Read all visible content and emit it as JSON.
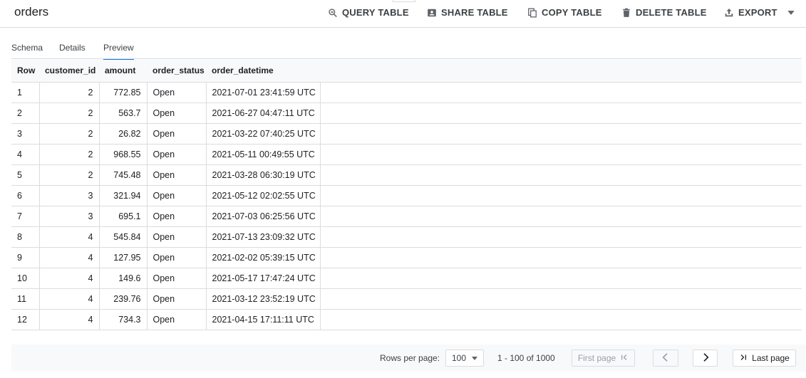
{
  "header": {
    "title": "orders",
    "actions": [
      {
        "label": "QUERY TABLE",
        "icon": "query-icon"
      },
      {
        "label": "SHARE TABLE",
        "icon": "share-icon"
      },
      {
        "label": "COPY TABLE",
        "icon": "copy-icon"
      },
      {
        "label": "DELETE TABLE",
        "icon": "trash-icon"
      },
      {
        "label": "EXPORT",
        "icon": "export-icon"
      }
    ]
  },
  "tabs": [
    {
      "label": "Schema",
      "active": false
    },
    {
      "label": "Details",
      "active": false
    },
    {
      "label": "Preview",
      "active": true
    }
  ],
  "table": {
    "columns": [
      "Row",
      "customer_id",
      "amount",
      "order_status",
      "order_datetime"
    ],
    "rows": [
      [
        "1",
        "2",
        "772.85",
        "Open",
        "2021-07-01 23:41:59 UTC"
      ],
      [
        "2",
        "2",
        "563.7",
        "Open",
        "2021-06-27 04:47:11 UTC"
      ],
      [
        "3",
        "2",
        "26.82",
        "Open",
        "2021-03-22 07:40:25 UTC"
      ],
      [
        "4",
        "2",
        "968.55",
        "Open",
        "2021-05-11 00:49:55 UTC"
      ],
      [
        "5",
        "2",
        "745.48",
        "Open",
        "2021-03-28 06:30:19 UTC"
      ],
      [
        "6",
        "3",
        "321.94",
        "Open",
        "2021-05-12 02:02:55 UTC"
      ],
      [
        "7",
        "3",
        "695.1",
        "Open",
        "2021-07-03 06:25:56 UTC"
      ],
      [
        "8",
        "4",
        "545.84",
        "Open",
        "2021-07-13 23:09:32 UTC"
      ],
      [
        "9",
        "4",
        "127.95",
        "Open",
        "2021-02-02 05:39:15 UTC"
      ],
      [
        "10",
        "4",
        "149.6",
        "Open",
        "2021-05-17 17:47:24 UTC"
      ],
      [
        "11",
        "4",
        "239.76",
        "Open",
        "2021-03-12 23:52:19 UTC"
      ],
      [
        "12",
        "4",
        "734.3",
        "Open",
        "2021-04-15 17:11:11 UTC"
      ]
    ]
  },
  "pager": {
    "rows_per_page_label": "Rows per page:",
    "rows_per_page_value": "100",
    "range_text": "1 - 100 of 1000",
    "first_page_label": "First page",
    "last_page_label": "Last page"
  },
  "colors": {
    "accent": "#1a73e8",
    "text": "#202124",
    "border": "#dadce0",
    "header_bg": "#f8f9fa"
  }
}
